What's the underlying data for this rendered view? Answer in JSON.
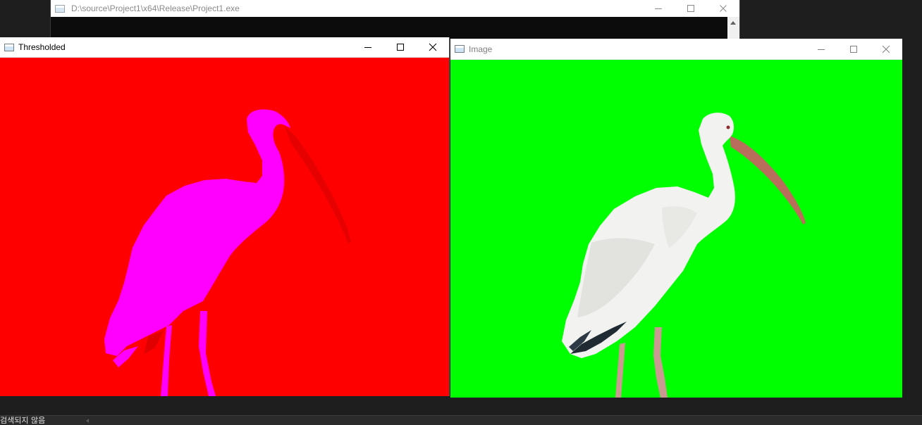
{
  "console_window": {
    "title": "D:\\source\\Project1\\x64\\Release\\Project1.exe",
    "icon": "console-app-icon"
  },
  "thresholded_window": {
    "title": "Thresholded",
    "icon": "opencv-window-icon",
    "colors": {
      "background": "#ff0000",
      "mask": "#ff00ff"
    }
  },
  "image_window": {
    "title": "Image",
    "icon": "opencv-window-icon",
    "colors": {
      "background": "#00ff00",
      "bird": "#f2f2f0",
      "beak": "#b86e5a"
    }
  },
  "window_controls": {
    "minimize": "minimize-icon",
    "maximize": "maximize-icon",
    "close": "close-icon"
  },
  "status_bar": {
    "text": "검색되지 않음"
  }
}
